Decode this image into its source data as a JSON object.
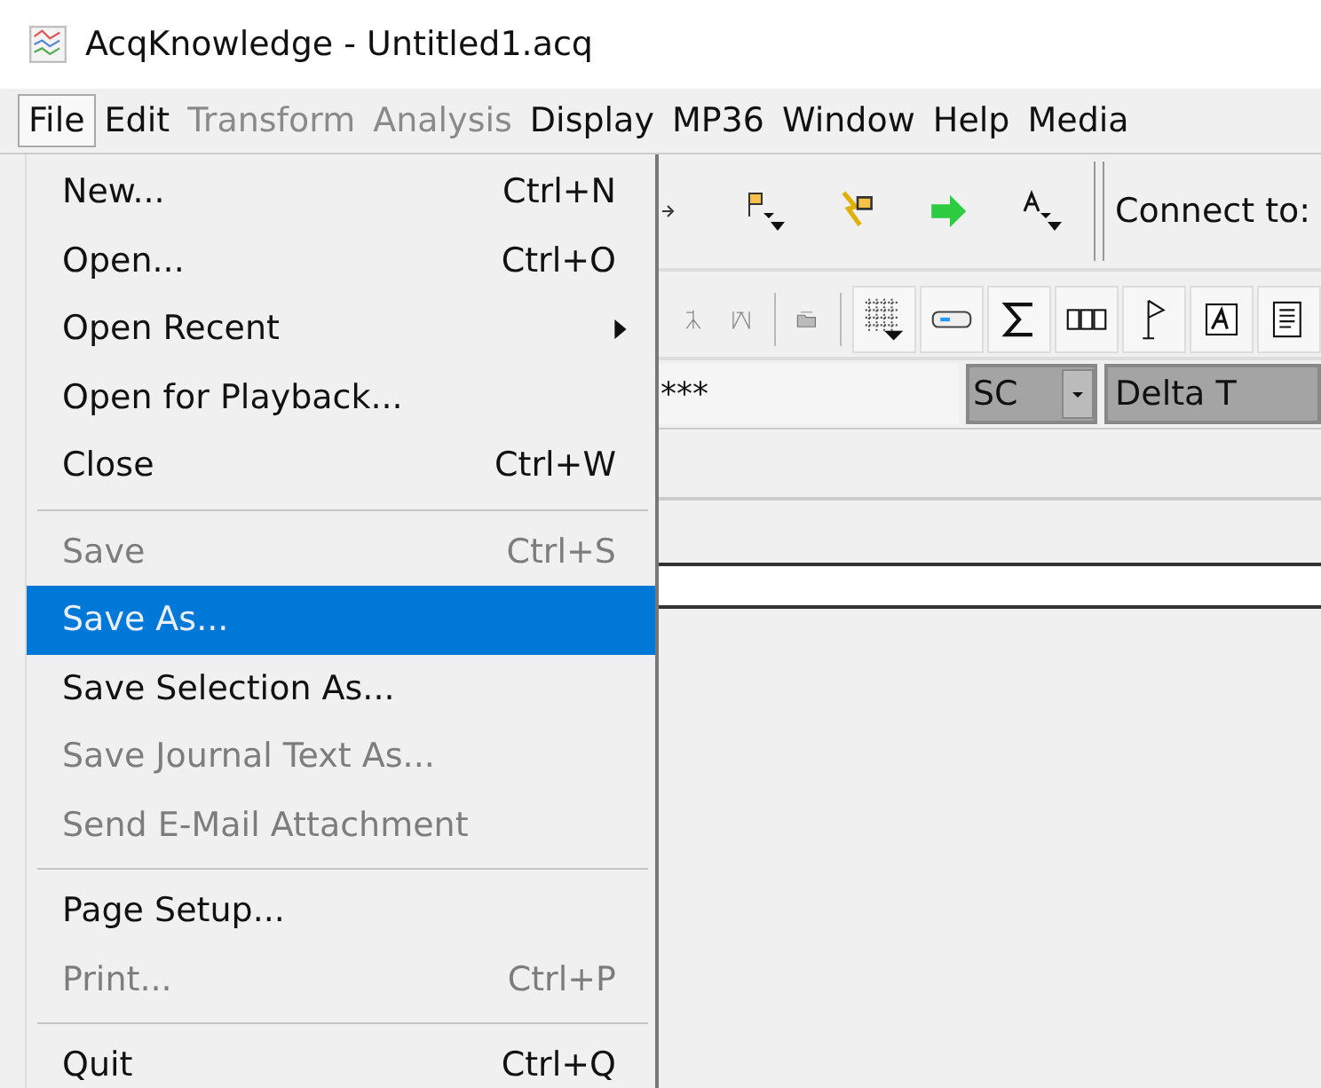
{
  "window": {
    "title": "AcqKnowledge - Untitled1.acq"
  },
  "menubar": [
    {
      "label": "File",
      "selected": true,
      "disabled": false
    },
    {
      "label": "Edit",
      "selected": false,
      "disabled": false
    },
    {
      "label": "Transform",
      "selected": false,
      "disabled": true
    },
    {
      "label": "Analysis",
      "selected": false,
      "disabled": true
    },
    {
      "label": "Display",
      "selected": false,
      "disabled": false
    },
    {
      "label": "MP36",
      "selected": false,
      "disabled": false
    },
    {
      "label": "Window",
      "selected": false,
      "disabled": false
    },
    {
      "label": "Help",
      "selected": false,
      "disabled": false
    },
    {
      "label": "Media",
      "selected": false,
      "disabled": false
    }
  ],
  "file_menu": [
    {
      "kind": "item",
      "label": "New...",
      "shortcut": "Ctrl+N",
      "disabled": false,
      "selected": false,
      "submenu": false
    },
    {
      "kind": "item",
      "label": "Open...",
      "shortcut": "Ctrl+O",
      "disabled": false,
      "selected": false,
      "submenu": false
    },
    {
      "kind": "item",
      "label": "Open Recent",
      "disabled": false,
      "selected": false,
      "submenu": true
    },
    {
      "kind": "item",
      "label": "Open for Playback...",
      "disabled": false,
      "selected": false,
      "submenu": false
    },
    {
      "kind": "item",
      "label": "Close",
      "shortcut": "Ctrl+W",
      "disabled": false,
      "selected": false,
      "submenu": false
    },
    {
      "kind": "separator"
    },
    {
      "kind": "item",
      "label": "Save",
      "shortcut": "Ctrl+S",
      "disabled": true,
      "selected": false,
      "submenu": false
    },
    {
      "kind": "item",
      "label": "Save As...",
      "disabled": false,
      "selected": true,
      "submenu": false
    },
    {
      "kind": "item",
      "label": "Save Selection As...",
      "disabled": false,
      "selected": false,
      "submenu": false
    },
    {
      "kind": "item",
      "label": "Save Journal Text As...",
      "disabled": true,
      "selected": false,
      "submenu": false
    },
    {
      "kind": "item",
      "label": "Send E-Mail Attachment",
      "disabled": true,
      "selected": false,
      "submenu": false
    },
    {
      "kind": "separator"
    },
    {
      "kind": "item",
      "label": "Page Setup...",
      "disabled": false,
      "selected": false,
      "submenu": false
    },
    {
      "kind": "item",
      "label": "Print...",
      "shortcut": "Ctrl+P",
      "disabled": true,
      "selected": false,
      "submenu": false
    },
    {
      "kind": "separator"
    },
    {
      "kind": "item",
      "label": "Quit",
      "shortcut": "Ctrl+Q",
      "disabled": false,
      "selected": false,
      "submenu": false
    }
  ],
  "toolbar": {
    "connect_label": "Connect to:"
  },
  "channel_bar": {
    "channel_value": "***",
    "measurement_channel": "SC",
    "measurement_type": "Delta T"
  }
}
